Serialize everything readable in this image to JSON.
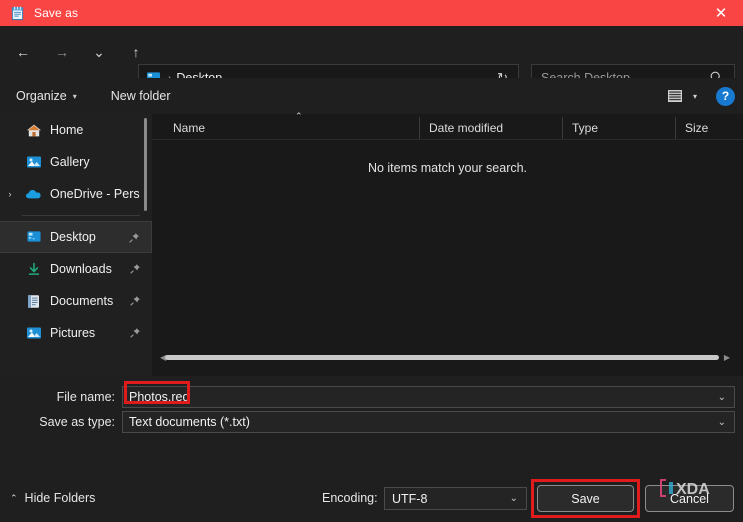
{
  "window": {
    "title": "Save as",
    "title_icon": "notepad-icon",
    "close_label": "✕",
    "titlebar_color": "#fa4545",
    "accent_color": "#1879d1",
    "highlight_color": "#e01b1b"
  },
  "nav": {
    "back": "←",
    "forward": "→",
    "recent": "⌄",
    "up": "↑",
    "refresh": "↻",
    "dropdown": "⌄",
    "breadcrumb_icon": "desktop-icon",
    "breadcrumb_separator": "›",
    "breadcrumb": "Desktop"
  },
  "search": {
    "placeholder": "Search Desktop",
    "value": "",
    "icon": "search-icon"
  },
  "toolbar": {
    "organize_label": "Organize",
    "organize_caret": "▾",
    "new_folder_label": "New folder",
    "view_icon": "list-view-icon",
    "view_caret": "▾",
    "help_label": "?"
  },
  "sidebar": {
    "items": [
      {
        "label": "Home",
        "icon": "home-icon",
        "expander": "",
        "pinned": false,
        "selected": false
      },
      {
        "label": "Gallery",
        "icon": "gallery-icon",
        "expander": "",
        "pinned": false,
        "selected": false
      },
      {
        "label": "OneDrive - Pers",
        "icon": "onedrive-icon",
        "expander": "›",
        "pinned": false,
        "selected": false
      },
      {
        "label": "Desktop",
        "icon": "desktop-icon",
        "expander": "",
        "pinned": true,
        "selected": true
      },
      {
        "label": "Downloads",
        "icon": "downloads-icon",
        "expander": "",
        "pinned": true,
        "selected": false
      },
      {
        "label": "Documents",
        "icon": "documents-icon",
        "expander": "",
        "pinned": true,
        "selected": false
      },
      {
        "label": "Pictures",
        "icon": "pictures-icon",
        "expander": "",
        "pinned": true,
        "selected": false
      }
    ]
  },
  "filelist": {
    "columns": [
      {
        "label": "Name",
        "sorted": "asc"
      },
      {
        "label": "Date modified",
        "sorted": ""
      },
      {
        "label": "Type",
        "sorted": ""
      },
      {
        "label": "Size",
        "sorted": ""
      }
    ],
    "sort_caret": "⌃",
    "empty_message": "No items match your search.",
    "rows": []
  },
  "form": {
    "file_name_label": "File name:",
    "file_name_value": "Photos.reg",
    "file_name_chevron": "⌄",
    "save_as_type_label": "Save as type:",
    "save_as_type_value": "Text documents (*.txt)",
    "save_as_type_chevron": "⌄"
  },
  "footer": {
    "hide_folders_caret": "⌃",
    "hide_folders_label": "Hide Folders",
    "encoding_label": "Encoding:",
    "encoding_value": "UTF-8",
    "encoding_chevron": "⌄",
    "save_label": "Save",
    "cancel_label": "Cancel",
    "watermark": "XDA"
  }
}
